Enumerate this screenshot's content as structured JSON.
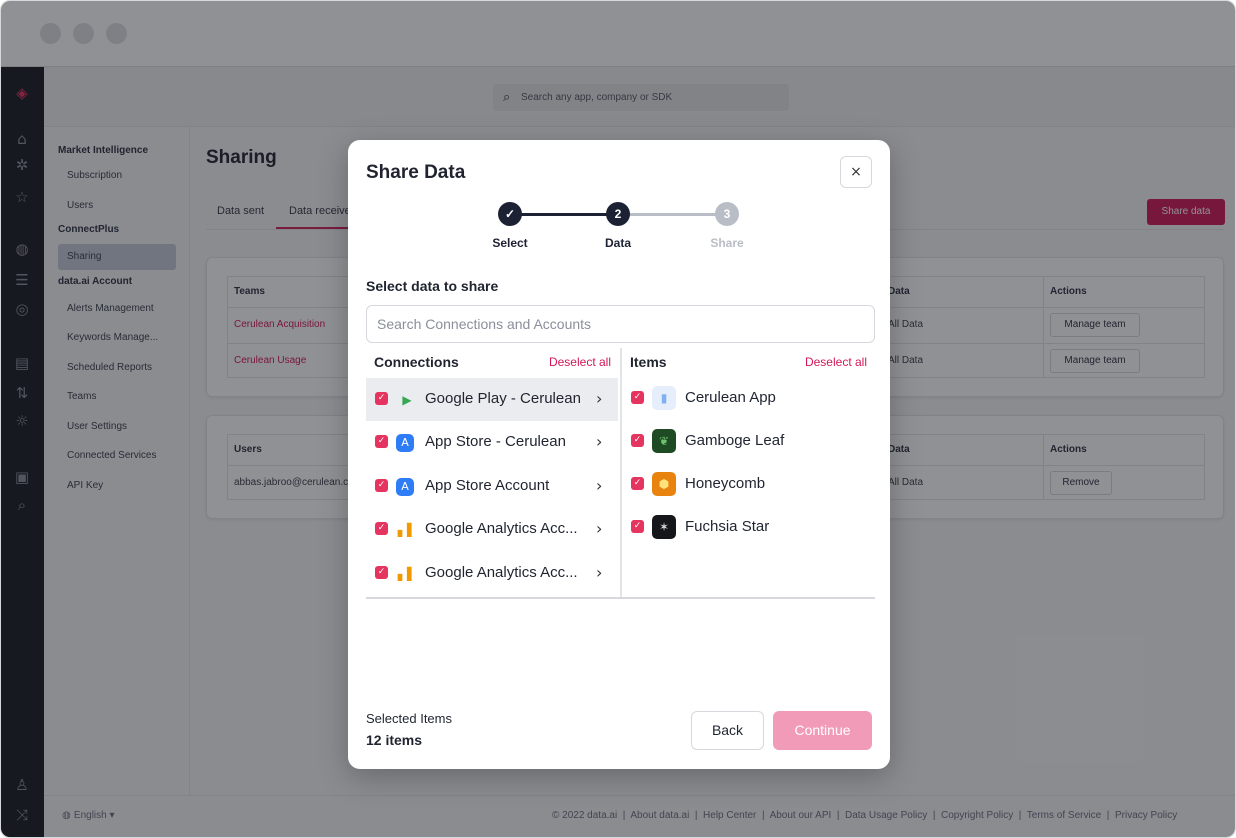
{
  "app": {
    "search_placeholder": "Search any app, company or SDK"
  },
  "sidenav": {
    "sections": [
      {
        "title": "Market Intelligence",
        "items": [
          "Subscription",
          "Users"
        ]
      },
      {
        "title": "ConnectPlus",
        "items": [
          "Sharing"
        ]
      },
      {
        "title": "data.ai Account",
        "items": [
          "Alerts Management",
          "Keywords Manage...",
          "Scheduled Reports",
          "Teams",
          "User Settings",
          "Connected Services",
          "API Key"
        ]
      }
    ],
    "active_item": "Sharing"
  },
  "page": {
    "title": "Sharing",
    "tabs": [
      "Data sent",
      "Data receive"
    ],
    "share_button": "Share data"
  },
  "teams_table": {
    "headers": [
      "Teams",
      "Data",
      "Actions"
    ],
    "rows": [
      {
        "team": "Cerulean Acquisition",
        "data": "All Data",
        "action": "Manage team"
      },
      {
        "team": "Cerulean Usage",
        "data": "All Data",
        "action": "Manage team"
      }
    ]
  },
  "users_table": {
    "headers": [
      "Users",
      "Data",
      "Actions"
    ],
    "rows": [
      {
        "user": "abbas.jabroo@cerulean.co",
        "data": "All Data",
        "action": "Remove"
      }
    ]
  },
  "footer": {
    "language": "English",
    "links": [
      "© 2022 data.ai",
      "About data.ai",
      "Help Center",
      "About our API",
      "Data Usage Policy",
      "Copyright Policy",
      "Terms of Service",
      "Privacy Policy"
    ]
  },
  "modal": {
    "title": "Share Data",
    "close": "×",
    "steps": [
      {
        "label": "Select",
        "marker": "✓",
        "state": "done"
      },
      {
        "label": "Data",
        "marker": "2",
        "state": "current"
      },
      {
        "label": "Share",
        "marker": "3",
        "state": "upcoming"
      }
    ],
    "section_title": "Select data to share",
    "search_placeholder": "Search Connections and Accounts",
    "connections": {
      "heading": "Connections",
      "deselect": "Deselect all",
      "items": [
        {
          "label": "Google Play - Cerulean",
          "icon": "google-play-icon",
          "checked": true,
          "selected": true
        },
        {
          "label": "App Store - Cerulean",
          "icon": "app-store-icon",
          "checked": true,
          "selected": false
        },
        {
          "label": "App Store Account",
          "icon": "app-store-icon",
          "checked": true,
          "selected": false
        },
        {
          "label": "Google Analytics Acc...",
          "icon": "google-analytics-icon",
          "checked": true,
          "selected": false
        },
        {
          "label": "Google Analytics Acc...",
          "icon": "google-analytics-icon",
          "checked": true,
          "selected": false
        }
      ]
    },
    "items": {
      "heading": "Items",
      "deselect": "Deselect all",
      "list": [
        {
          "label": "Cerulean App",
          "icon": "cerulean-app-icon",
          "checked": true
        },
        {
          "label": "Gamboge Leaf",
          "icon": "gamboge-leaf-icon",
          "checked": true
        },
        {
          "label": "Honeycomb",
          "icon": "honeycomb-icon",
          "checked": true
        },
        {
          "label": "Fuchsia Star",
          "icon": "fuchsia-star-icon",
          "checked": true
        }
      ]
    },
    "selected_label": "Selected Items",
    "selected_count": "12 items",
    "back": "Back",
    "continue": "Continue"
  },
  "colors": {
    "accent": "#d2195a",
    "step_done": "#1c2233",
    "step_upcoming": "#b9bdc6",
    "continue_disabled": "#f29bb8"
  }
}
